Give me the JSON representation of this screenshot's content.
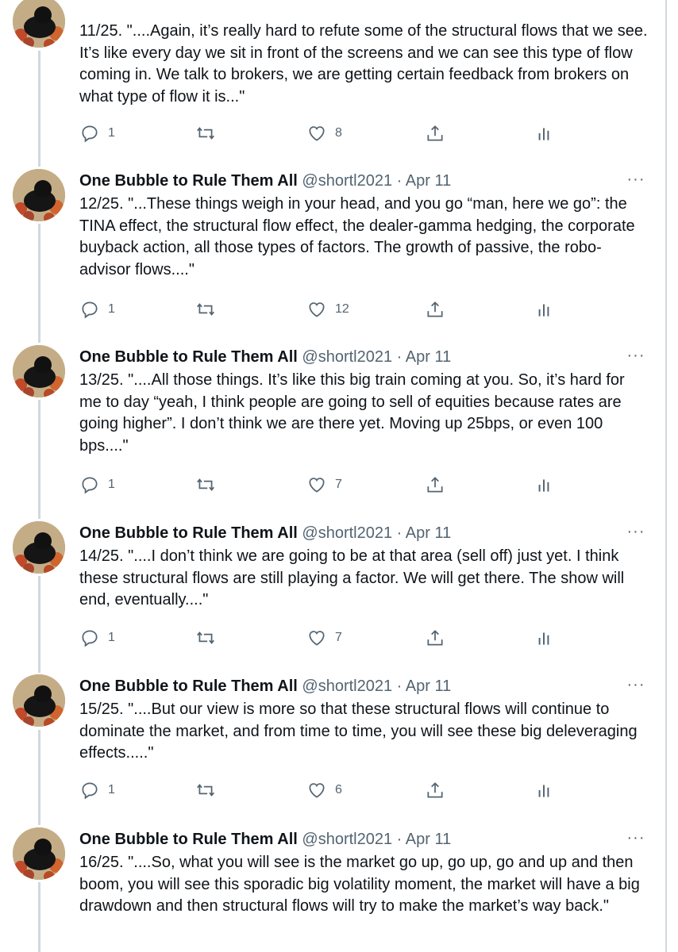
{
  "colors": {
    "text": "#0f1419",
    "secondary": "#536471",
    "thread_line": "#cfd9de"
  },
  "icons": {
    "reply": "reply-icon",
    "retweet": "retweet-icon",
    "like": "heart-icon",
    "share": "share-icon",
    "analytics": "analytics-icon",
    "more": "more-icon"
  },
  "tweets": [
    {
      "text": "11/25. \"....Again, it’s really hard to refute some of the structural flows that we see. It’s like every day we sit in front of the screens and we can see this type of flow coming in. We talk to brokers, we are getting certain feedback from brokers on what type of flow it is...\"",
      "replies": "1",
      "likes": "8"
    },
    {
      "name": "One Bubble to Rule Them All",
      "handle": "@shortl2021",
      "date": "Apr 11",
      "text": "12/25. \"...These things weigh in your head, and you go “man, here we go”: the TINA effect, the structural flow effect, the dealer-gamma hedging, the corporate buyback action, all those types of factors. The growth of passive, the robo-advisor flows....\"",
      "replies": "1",
      "likes": "12"
    },
    {
      "name": "One Bubble to Rule Them All",
      "handle": "@shortl2021",
      "date": "Apr 11",
      "text": "13/25. \"....All those things. It’s like this big train coming at you. So, it’s hard for me to day “yeah, I think people are going to sell of equities because rates are going higher”. I don’t think we are there yet. Moving up 25bps, or even 100 bps....\"",
      "replies": "1",
      "likes": "7"
    },
    {
      "name": "One Bubble to Rule Them All",
      "handle": "@shortl2021",
      "date": "Apr 11",
      "text": "14/25. \"....I don’t think we are going to be at that area (sell off) just yet. I think these structural flows are still playing a factor. We will get there. The show will end, eventually....\"",
      "replies": "1",
      "likes": "7"
    },
    {
      "name": "One Bubble to Rule Them All",
      "handle": "@shortl2021",
      "date": "Apr 11",
      "text": "15/25. \"....But our view is more so that these structural flows will continue to dominate the market, and from time to time, you will see these big deleveraging effects.....\"",
      "replies": "1",
      "likes": "6"
    },
    {
      "name": "One Bubble to Rule Them All",
      "handle": "@shortl2021",
      "date": "Apr 11",
      "text": "16/25. \"....So, what you will see is the market go up, go up, go and up and then boom, you will see this sporadic big volatility moment, the market will have a big drawdown and then structural flows will try to make the market’s way back.\""
    }
  ]
}
